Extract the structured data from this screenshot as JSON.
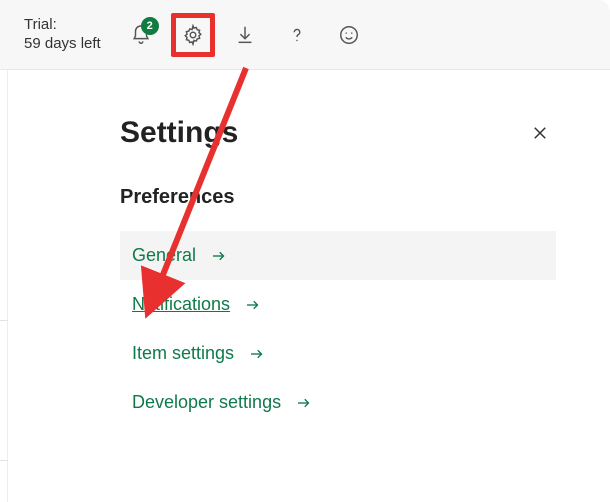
{
  "topbar": {
    "trial_line1": "Trial:",
    "trial_line2": "59 days left",
    "notification_count": "2",
    "icons": {
      "bell": "bell-icon",
      "gear": "gear-icon",
      "download": "download-icon",
      "help": "help-icon",
      "feedback": "smiley-icon"
    }
  },
  "panel": {
    "title": "Settings",
    "section": "Preferences",
    "items": [
      {
        "label": "General",
        "hover": true
      },
      {
        "label": "Notifications",
        "underlined": true
      },
      {
        "label": "Item settings"
      },
      {
        "label": "Developer settings"
      }
    ]
  },
  "annotation": {
    "highlight_target": "gear-icon",
    "arrow_target": "Notifications",
    "color": "#e8312f"
  }
}
